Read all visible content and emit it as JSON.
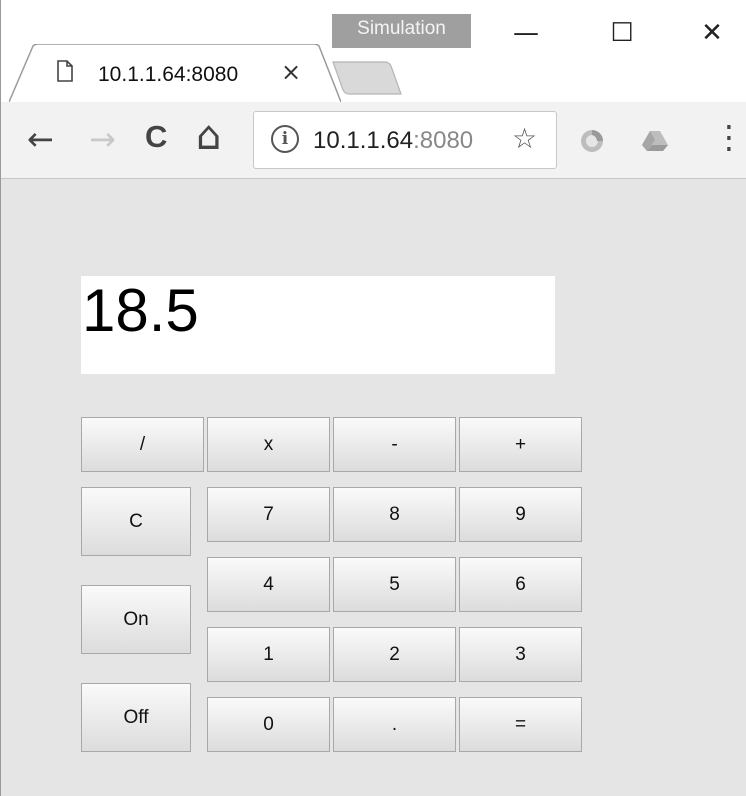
{
  "window": {
    "badge": "Simulation",
    "minimize": "—",
    "maximize": "☐",
    "close": "✕"
  },
  "tab": {
    "title": "10.1.1.64:8080",
    "close": "×",
    "icon": "document-icon"
  },
  "toolbar": {
    "back": "←",
    "forward": "→",
    "reload": "C",
    "home": "⌂",
    "address_host": "10.1.1.64",
    "address_port": ":8080",
    "info": "i",
    "star": "☆",
    "menu": "⋮",
    "extension_icons": [
      "chrome-extension-icon",
      "drive-icon"
    ]
  },
  "calculator": {
    "display": "18.5",
    "ops": [
      "/",
      "x",
      "-",
      "+"
    ],
    "side": [
      "C",
      "On",
      "Off"
    ],
    "digits_row1": [
      "7",
      "8",
      "9"
    ],
    "digits_row2": [
      "4",
      "5",
      "6"
    ],
    "digits_row3": [
      "1",
      "2",
      "3"
    ],
    "bottom_row": [
      "0",
      ".",
      "="
    ]
  }
}
